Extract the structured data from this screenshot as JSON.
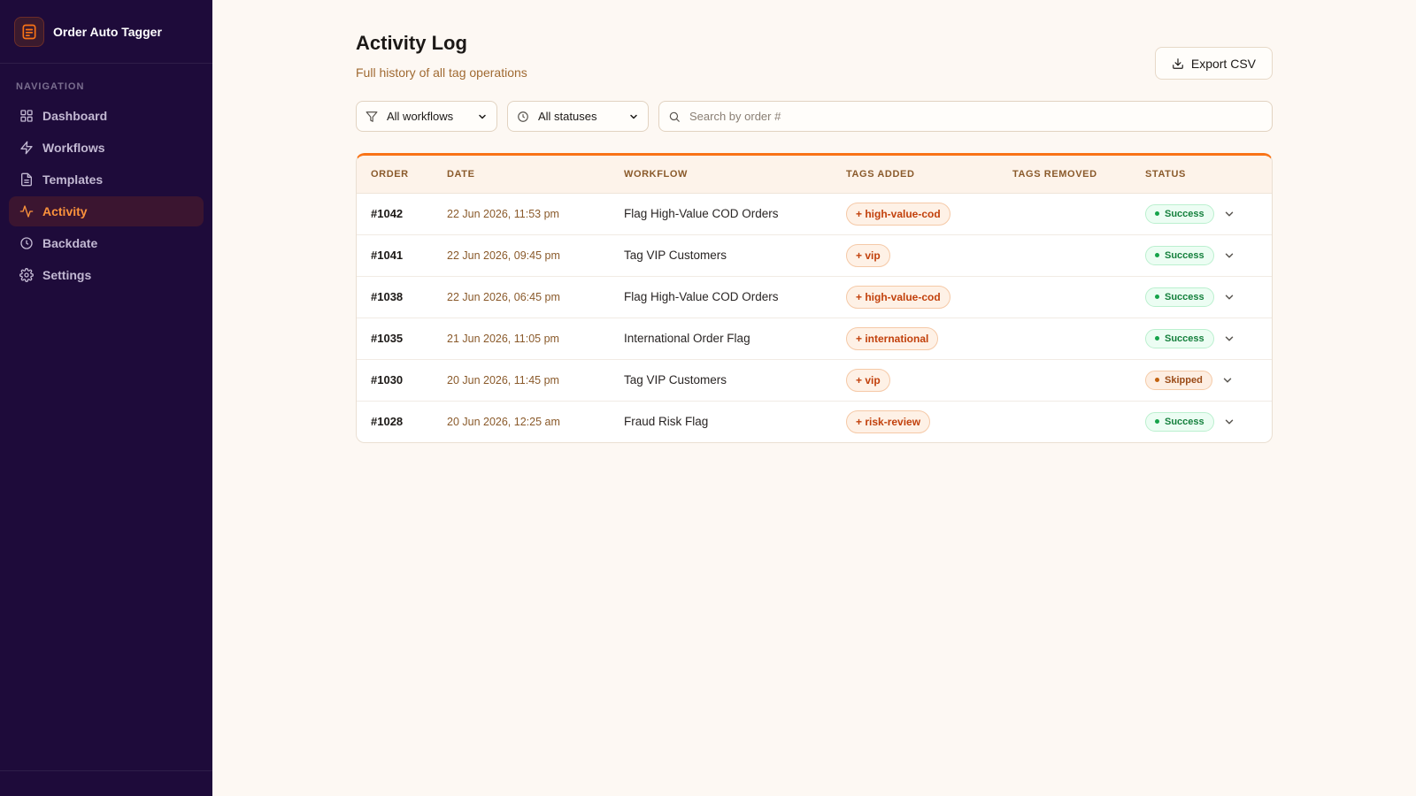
{
  "app": {
    "name": "Order Auto Tagger",
    "logo_icon": "document-list-icon",
    "accent": "#f97316",
    "sidebar_bg": "#1e0b3a"
  },
  "sidebar": {
    "heading": "NAVIGATION",
    "items": [
      {
        "label": "Dashboard",
        "icon": "grid-icon",
        "active": false
      },
      {
        "label": "Workflows",
        "icon": "lightning-icon",
        "active": false
      },
      {
        "label": "Templates",
        "icon": "file-icon",
        "active": false
      },
      {
        "label": "Activity",
        "icon": "pulse-icon",
        "active": true
      },
      {
        "label": "Backdate",
        "icon": "clock-icon",
        "active": false
      },
      {
        "label": "Settings",
        "icon": "gear-icon",
        "active": false
      }
    ]
  },
  "header": {
    "title": "Activity Log",
    "subtitle": "Full history of all tag operations",
    "export_label": "Export CSV"
  },
  "filters": {
    "workflow": {
      "value": "All workflows",
      "icon": "filter-icon"
    },
    "status": {
      "value": "All statuses",
      "icon": "clock-icon"
    },
    "search": {
      "placeholder": "Search by order #",
      "value": ""
    }
  },
  "table": {
    "columns": [
      "ORDER",
      "DATE",
      "WORKFLOW",
      "TAGS ADDED",
      "TAGS REMOVED",
      "STATUS"
    ],
    "rows": [
      {
        "order": "#1042",
        "date": "22 Jun 2026, 11:53 pm",
        "workflow": "Flag High-Value COD Orders",
        "tags_added": "+ high-value-cod",
        "tags_removed": "",
        "status": "Success",
        "status_type": "success"
      },
      {
        "order": "#1041",
        "date": "22 Jun 2026, 09:45 pm",
        "workflow": "Tag VIP Customers",
        "tags_added": "+ vip",
        "tags_removed": "",
        "status": "Success",
        "status_type": "success"
      },
      {
        "order": "#1038",
        "date": "22 Jun 2026, 06:45 pm",
        "workflow": "Flag High-Value COD Orders",
        "tags_added": "+ high-value-cod",
        "tags_removed": "",
        "status": "Success",
        "status_type": "success"
      },
      {
        "order": "#1035",
        "date": "21 Jun 2026, 11:05 pm",
        "workflow": "International Order Flag",
        "tags_added": "+ international",
        "tags_removed": "",
        "status": "Success",
        "status_type": "success"
      },
      {
        "order": "#1030",
        "date": "20 Jun 2026, 11:45 pm",
        "workflow": "Tag VIP Customers",
        "tags_added": "+ vip",
        "tags_removed": "",
        "status": "Skipped",
        "status_type": "skipped"
      },
      {
        "order": "#1028",
        "date": "20 Jun 2026, 12:25 am",
        "workflow": "Fraud Risk Flag",
        "tags_added": "+ risk-review",
        "tags_removed": "",
        "status": "Success",
        "status_type": "success"
      }
    ]
  }
}
